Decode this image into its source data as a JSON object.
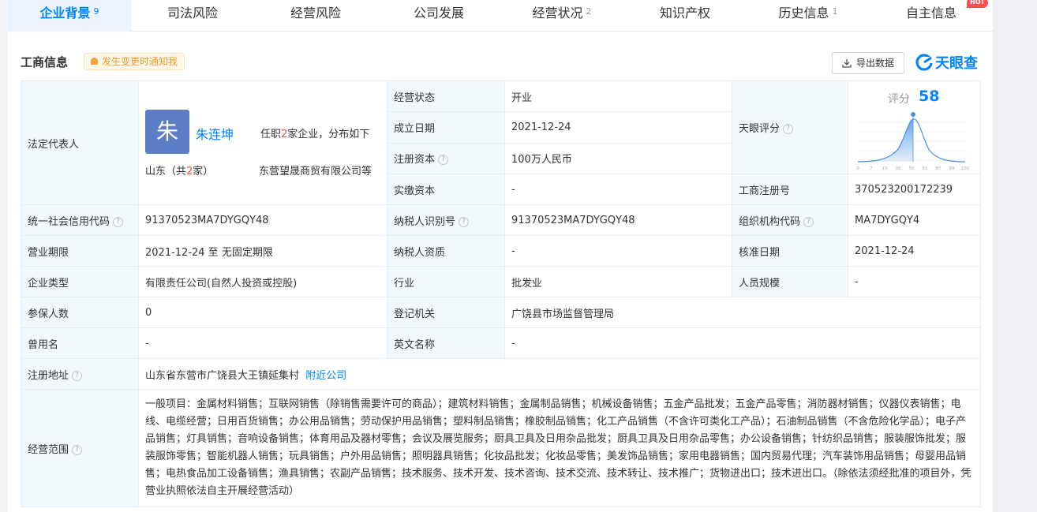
{
  "tabs": [
    {
      "label": "企业背景",
      "count": "9",
      "active": true
    },
    {
      "label": "司法风险",
      "count": ""
    },
    {
      "label": "经营风险",
      "count": ""
    },
    {
      "label": "公司发展",
      "count": ""
    },
    {
      "label": "经营状况",
      "count": "2"
    },
    {
      "label": "知识产权",
      "count": ""
    },
    {
      "label": "历史信息",
      "count": "1"
    },
    {
      "label": "自主信息",
      "count": "",
      "badge": "HOT"
    }
  ],
  "section": {
    "title": "工商信息",
    "notify": "发生变更时通知我",
    "export": "导出数据",
    "logo": "天眼查"
  },
  "rep": {
    "label": "法定代表人",
    "avatar": "朱",
    "name": "朱连坤",
    "pos_pre": "任职",
    "pos_num": "2",
    "pos_post": "家企业，分布如下",
    "region_pre": "山东（共",
    "region_num": "2",
    "region_post": "家）",
    "company": "东营望晟商贸有限公司等"
  },
  "fields": {
    "status_label": "经营状态",
    "status": "开业",
    "founded_label": "成立日期",
    "founded": "2021-12-24",
    "reg_capital_label": "注册资本",
    "reg_capital": "100万人民币",
    "paid_capital_label": "实缴资本",
    "paid_capital": "-",
    "score_label": "天眼评分",
    "reg_no_label": "工商注册号",
    "reg_no": "370523200172239",
    "credit_code_label": "统一社会信用代码",
    "credit_code": "91370523MA7DYGQY48",
    "taxpayer_id_label": "纳税人识别号",
    "taxpayer_id": "91370523MA7DYGQY48",
    "org_code_label": "组织机构代码",
    "org_code": "MA7DYGQY4",
    "term_label": "营业期限",
    "term": "2021-12-24 至 无固定期限",
    "taxpayer_qual_label": "纳税人资质",
    "taxpayer_qual": "-",
    "approve_date_label": "核准日期",
    "approve_date": "2021-12-24",
    "type_label": "企业类型",
    "type": "有限责任公司(自然人投资或控股)",
    "industry_label": "行业",
    "industry": "批发业",
    "staff_label": "人员规模",
    "staff": "-",
    "insured_label": "参保人数",
    "insured": "0",
    "authority_label": "登记机关",
    "authority": "广饶县市场监督管理局",
    "former_name_label": "曾用名",
    "former_name": "-",
    "en_name_label": "英文名称",
    "en_name": "-",
    "address_label": "注册地址",
    "address": "山东省东营市广饶县大王镇延集村",
    "nearby": "附近公司",
    "scope_label": "经营范围",
    "scope": "一般项目：金属材料销售；互联网销售（除销售需要许可的商品）；建筑材料销售；金属制品销售；机械设备销售；五金产品批发；五金产品零售；消防器材销售；仪器仪表销售；电线、电缆经营；日用百货销售；办公用品销售；劳动保护用品销售；塑料制品销售；橡胶制品销售；化工产品销售（不含许可类化工产品）；石油制品销售（不含危险化学品）；电子产品销售；灯具销售；音响设备销售；体育用品及器材零售；会议及展览服务；厨具卫具及日用杂品批发；厨具卫具及日用杂品零售；办公设备销售；针纺织品销售；服装服饰批发；服装服饰零售；智能机器人销售；玩具销售；户外用品销售；照明器具销售；化妆品批发；化妆品零售；美发饰品销售；家用电器销售；国内贸易代理；汽车装饰用品销售；母婴用品销售；电热食品加工设备销售；渔具销售；农副产品销售；技术服务、技术开发、技术咨询、技术交流、技术转让、技术推广；货物进出口；技术进出口。（除依法须经批准的项目外，凭营业执照依法自主开展经营活动）"
  },
  "score": {
    "label": "评分",
    "value": "58",
    "axis": [
      "0",
      "7",
      "15",
      "30",
      "50",
      "65",
      "87",
      "99",
      "100"
    ]
  },
  "colors": {
    "accent": "#0084ff",
    "label_bg": "#f2f9fc",
    "red": "#ff4d4f"
  }
}
